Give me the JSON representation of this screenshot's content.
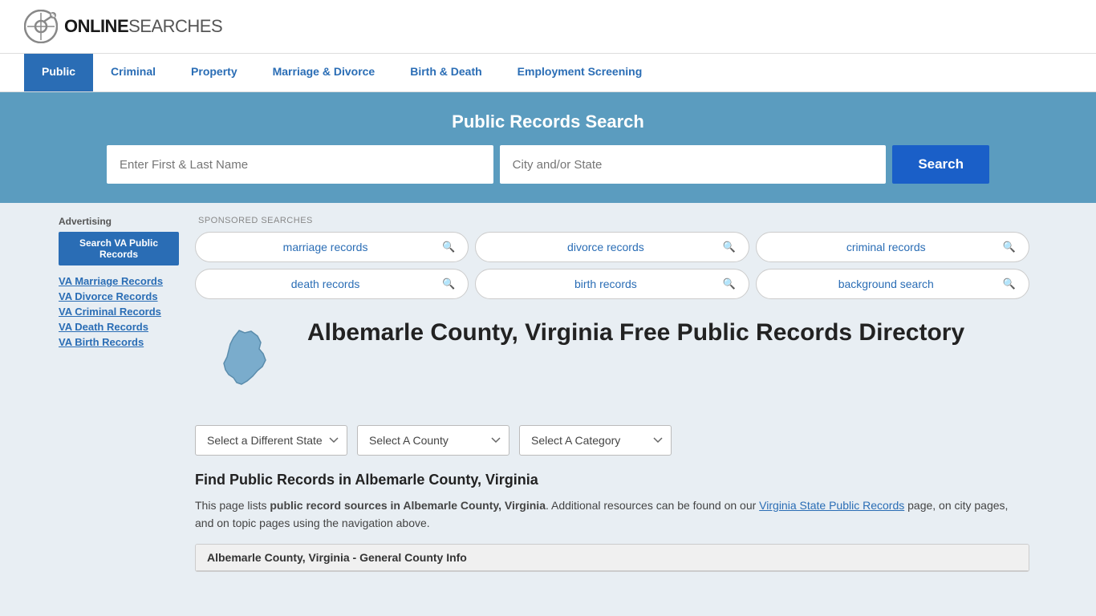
{
  "header": {
    "logo_online": "ONLINE",
    "logo_searches": "SEARCHES"
  },
  "nav": {
    "items": [
      {
        "label": "Public",
        "active": true
      },
      {
        "label": "Criminal",
        "active": false
      },
      {
        "label": "Property",
        "active": false
      },
      {
        "label": "Marriage & Divorce",
        "active": false
      },
      {
        "label": "Birth & Death",
        "active": false
      },
      {
        "label": "Employment Screening",
        "active": false
      }
    ]
  },
  "search_banner": {
    "title": "Public Records Search",
    "name_placeholder": "Enter First & Last Name",
    "location_placeholder": "City and/or State",
    "button_label": "Search"
  },
  "sponsored": {
    "label": "SPONSORED SEARCHES",
    "items": [
      {
        "text": "marriage records"
      },
      {
        "text": "divorce records"
      },
      {
        "text": "criminal records"
      },
      {
        "text": "death records"
      },
      {
        "text": "birth records"
      },
      {
        "text": "background search"
      }
    ]
  },
  "page": {
    "title": "Albemarle County, Virginia Free Public Records Directory",
    "state_dropdown": "Select a Different State",
    "county_dropdown": "Select A County",
    "category_dropdown": "Select A Category",
    "find_title": "Find Public Records in Albemarle County, Virginia",
    "find_description_1": "This page lists ",
    "find_description_bold": "public record sources in Albemarle County, Virginia",
    "find_description_2": ". Additional resources can be found on our ",
    "find_description_link": "Virginia State Public Records",
    "find_description_3": " page, on city pages, and on topic pages using the navigation above.",
    "county_info_title": "Albemarle County, Virginia - General County Info"
  },
  "sidebar": {
    "ad_label": "Advertising",
    "ad_button": "Search VA Public Records",
    "links": [
      "VA Marriage Records",
      "VA Divorce Records",
      "VA Criminal Records",
      "VA Death Records",
      "VA Birth Records"
    ]
  }
}
